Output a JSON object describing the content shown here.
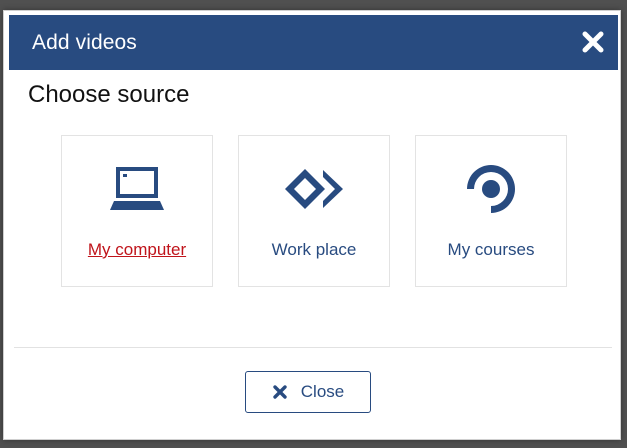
{
  "dialog": {
    "title": "Add videos",
    "close_icon": "close-icon",
    "subtitle": "Choose source"
  },
  "sources": [
    {
      "label": "My computer",
      "icon": "laptop-icon",
      "active": true
    },
    {
      "label": "Work place",
      "icon": "workplace-icon",
      "active": false
    },
    {
      "label": "My courses",
      "icon": "courses-icon",
      "active": false
    }
  ],
  "footer": {
    "close_label": "Close",
    "close_icon": "close-icon"
  },
  "colors": {
    "header": "#284b80",
    "accent": "#284b80",
    "active_link": "#c0141b"
  }
}
